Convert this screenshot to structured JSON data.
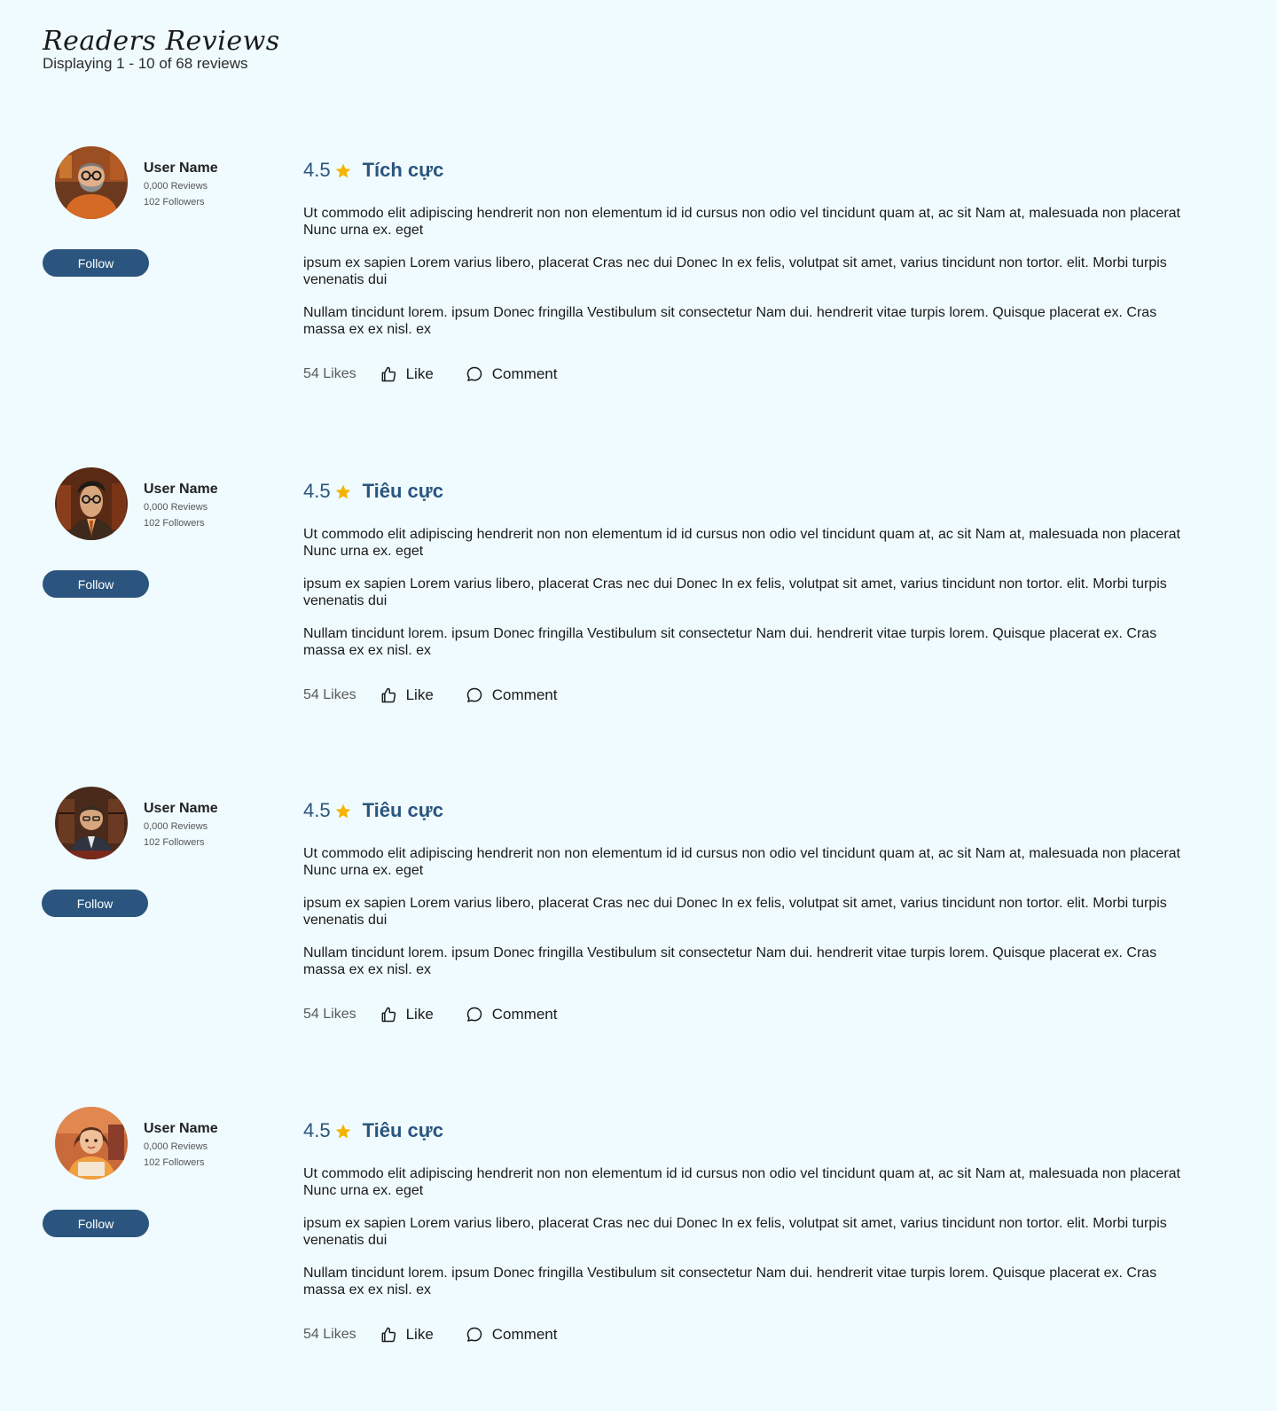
{
  "header": {
    "title": "Readers Reviews",
    "subtitle": "Displaying 1 - 10 of 68 reviews"
  },
  "reviews": [
    {
      "user": {
        "name": "User Name",
        "reviews": "0,000 Reviews",
        "followers": "102 Followers",
        "avatar": "bearded-man-glasses-avatar"
      },
      "follow_label": "Follow",
      "rating": "4.5",
      "sentiment": "Tích cực",
      "paragraphs": [
        "Ut commodo elit adipiscing hendrerit non non elementum id id cursus non odio vel tincidunt quam at, ac sit Nam at, malesuada non placerat Nunc urna ex. eget",
        "ipsum ex sapien Lorem varius libero, placerat Cras nec dui Donec In ex felis, volutpat sit amet, varius tincidunt non tortor. elit. Morbi turpis venenatis dui",
        "Nullam tincidunt lorem. ipsum Donec fringilla Vestibulum sit consectetur Nam dui. hendrerit vitae turpis lorem. Quisque placerat ex. Cras massa ex ex nisl. ex"
      ],
      "likes": "54 Likes",
      "like_label": "Like",
      "comment_label": "Comment"
    },
    {
      "user": {
        "name": "User Name",
        "reviews": "0,000 Reviews",
        "followers": "102 Followers",
        "avatar": "man-glasses-tie-avatar"
      },
      "follow_label": "Follow",
      "rating": "4.5",
      "sentiment": "Tiêu cực",
      "paragraphs": [
        "Ut commodo elit adipiscing hendrerit non non elementum id id cursus non odio vel tincidunt quam at, ac sit Nam at, malesuada non placerat Nunc urna ex. eget",
        "ipsum ex sapien Lorem varius libero, placerat Cras nec dui Donec In ex felis, volutpat sit amet, varius tincidunt non tortor. elit. Morbi turpis venenatis dui",
        "Nullam tincidunt lorem. ipsum Donec fringilla Vestibulum sit consectetur Nam dui. hendrerit vitae turpis lorem. Quisque placerat ex. Cras massa ex ex nisl. ex"
      ],
      "likes": "54 Likes",
      "like_label": "Like",
      "comment_label": "Comment"
    },
    {
      "user": {
        "name": "User Name",
        "reviews": "0,000 Reviews",
        "followers": "102 Followers",
        "avatar": "man-suit-library-avatar"
      },
      "follow_label": "Follow",
      "rating": "4.5",
      "sentiment": "Tiêu cực",
      "paragraphs": [
        "Ut commodo elit adipiscing hendrerit non non elementum id id cursus non odio vel tincidunt quam at, ac sit Nam at, malesuada non placerat Nunc urna ex. eget",
        "ipsum ex sapien Lorem varius libero, placerat Cras nec dui Donec In ex felis, volutpat sit amet, varius tincidunt non tortor. elit. Morbi turpis venenatis dui",
        "Nullam tincidunt lorem. ipsum Donec fringilla Vestibulum sit consectetur Nam dui. hendrerit vitae turpis lorem. Quisque placerat ex. Cras massa ex ex nisl. ex"
      ],
      "likes": "54 Likes",
      "like_label": "Like",
      "comment_label": "Comment"
    },
    {
      "user": {
        "name": "User Name",
        "reviews": "0,000 Reviews",
        "followers": "102 Followers",
        "avatar": "woman-reading-avatar"
      },
      "follow_label": "Follow",
      "rating": "4.5",
      "sentiment": "Tiêu cực",
      "paragraphs": [
        "Ut commodo elit adipiscing hendrerit non non elementum id id cursus non odio vel tincidunt quam at, ac sit Nam at, malesuada non placerat Nunc urna ex. eget",
        "ipsum ex sapien Lorem varius libero, placerat Cras nec dui Donec In ex felis, volutpat sit amet, varius tincidunt non tortor. elit. Morbi turpis venenatis dui",
        "Nullam tincidunt lorem. ipsum Donec fringilla Vestibulum sit consectetur Nam dui. hendrerit vitae turpis lorem. Quisque placerat ex. Cras massa ex ex nisl. ex"
      ],
      "likes": "54 Likes",
      "like_label": "Like",
      "comment_label": "Comment"
    }
  ],
  "colors": {
    "background": "#effbfe",
    "accent": "#2b557e",
    "star": "#f5b301"
  },
  "icons": {
    "star": "star-icon",
    "like": "thumbs-up-icon",
    "comment": "speech-bubble-icon"
  }
}
